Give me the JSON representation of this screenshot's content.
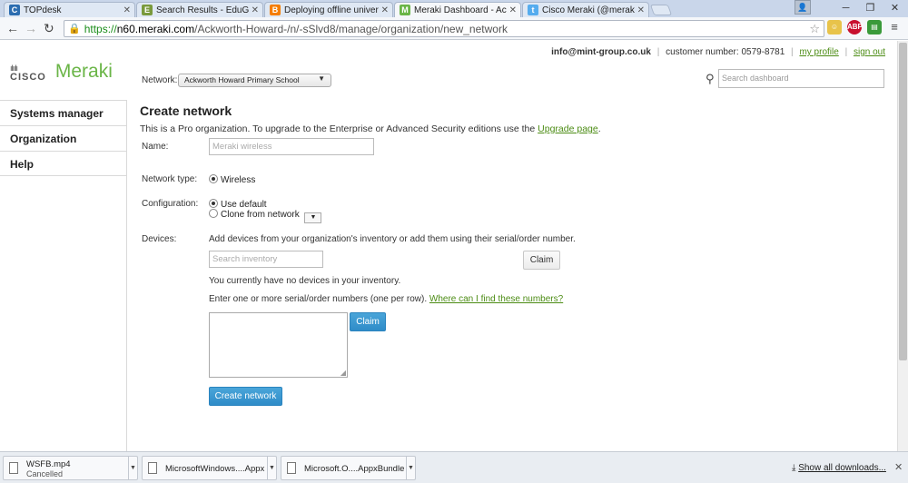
{
  "browser": {
    "tabs": [
      {
        "title": "TOPdesk",
        "icon": "C",
        "icon_color": "#2b6cb0"
      },
      {
        "title": "Search Results - EduGeek.",
        "icon": "E",
        "icon_color": "#7a9a3c"
      },
      {
        "title": "Deploying offline universa",
        "icon": "B",
        "icon_color": "#f57d00"
      },
      {
        "title": "Meraki Dashboard - Ackw",
        "icon": "M",
        "icon_color": "#6ab547"
      },
      {
        "title": "Cisco Meraki (@meraki) | T",
        "icon": "t",
        "icon_color": "#55acee"
      }
    ],
    "url_scheme": "https://",
    "url_host": "n60.meraki.com",
    "url_path": "/Ackworth-Howard-/n/-sSlvd8/manage/organization/new_network",
    "ext_abp": "ABP"
  },
  "header": {
    "cisco": "CISCO",
    "meraki": "Meraki",
    "email": "info@mint-group.co.uk",
    "customer_number": "customer number: 0579-8781",
    "my_profile": "my profile",
    "sign_out": "sign out",
    "network_label": "Network:",
    "network_value": "Ackworth Howard Primary School",
    "search_placeholder": "Search dashboard"
  },
  "sidebar": {
    "items": [
      {
        "label": "Systems manager"
      },
      {
        "label": "Organization"
      },
      {
        "label": "Help"
      }
    ]
  },
  "form": {
    "title": "Create network",
    "intro_text": "This is a Pro organization. To upgrade to the Enterprise or Advanced Security editions use the",
    "upgrade_link": "Upgrade page",
    "name_label": "Name:",
    "name_placeholder": "Meraki wireless",
    "type_label": "Network type:",
    "type_option": "Wireless",
    "config_label": "Configuration:",
    "config_default": "Use default",
    "config_clone": "Clone from network",
    "devices_label": "Devices:",
    "devices_help": "Add devices from your organization's inventory or add them using their serial/order number.",
    "inventory_placeholder": "Search inventory",
    "claim_label": "Claim",
    "no_devices": "You currently have no devices in your inventory.",
    "serial_help": "Enter one or more serial/order numbers (one per row).",
    "find_link": "Where can I find these numbers?",
    "claim_blue_label": "Claim",
    "create_button": "Create network"
  },
  "downloads": {
    "items": [
      {
        "name": "WSFB.mp4",
        "status": "Cancelled"
      },
      {
        "name": "MicrosoftWindows....Appx",
        "status": ""
      },
      {
        "name": "Microsoft.O....AppxBundle",
        "status": ""
      }
    ],
    "show_all": "Show all downloads..."
  }
}
